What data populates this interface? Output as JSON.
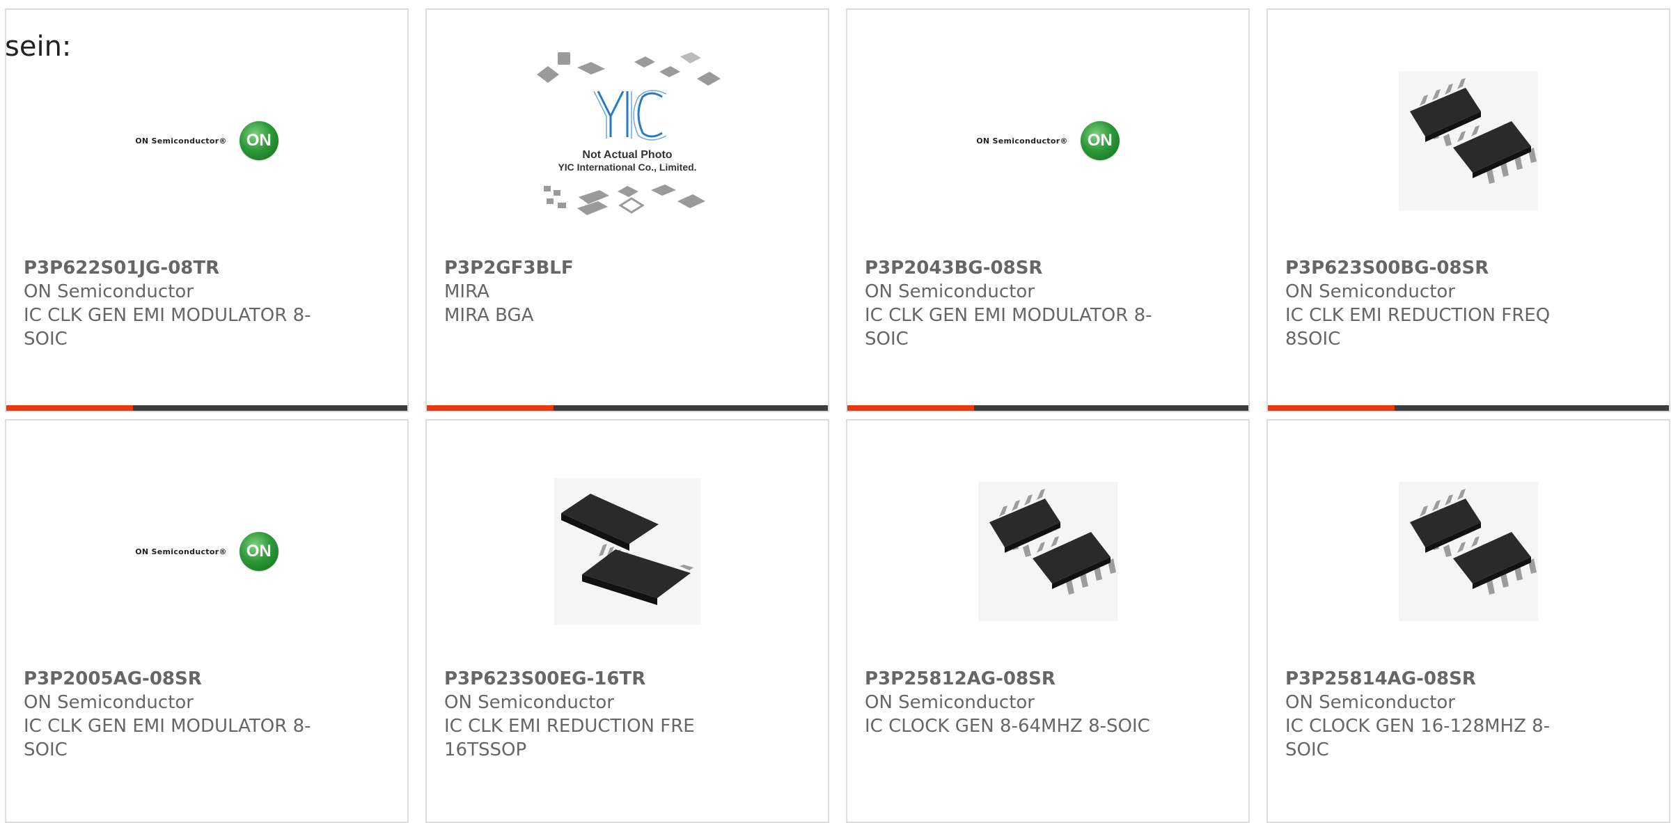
{
  "intro_text": "sein:",
  "colors": {
    "accent": "#e8380d",
    "bar": "#3d3d3d",
    "border": "#dddddd",
    "text": "#666666"
  },
  "products": [
    {
      "part": "P3P622S01JG-08TR",
      "manufacturer": "ON Semiconductor",
      "description": "IC CLK GEN EMI MODULATOR 8-SOIC",
      "image": "on-semiconductor-logo",
      "logo_text": "ON Semiconductor®",
      "logo_mark": "ON"
    },
    {
      "part": "P3P2GF3BLF",
      "manufacturer": "MIRA",
      "description": "MIRA BGA",
      "image": "yic-placeholder-photo",
      "placeholder_logo": "YIC",
      "placeholder_line1": "Not Actual Photo",
      "placeholder_line2": "YIC International Co., Limited."
    },
    {
      "part": "P3P2043BG-08SR",
      "manufacturer": "ON Semiconductor",
      "description": "IC CLK GEN EMI MODULATOR 8-SOIC",
      "image": "on-semiconductor-logo",
      "logo_text": "ON Semiconductor®",
      "logo_mark": "ON"
    },
    {
      "part": "P3P623S00BG-08SR",
      "manufacturer": "ON Semiconductor",
      "description": "IC CLK EMI REDUCTION FREQ 8SOIC",
      "image": "soic8-chip-photo"
    },
    {
      "part": "P3P2005AG-08SR",
      "manufacturer": "ON Semiconductor",
      "description": "IC CLK GEN EMI MODULATOR 8-SOIC",
      "image": "on-semiconductor-logo",
      "logo_text": "ON Semiconductor®",
      "logo_mark": "ON"
    },
    {
      "part": "P3P623S00EG-16TR",
      "manufacturer": "ON Semiconductor",
      "description": "IC CLK EMI REDUCTION FRE 16TSSOP",
      "image": "tssop16-chip-photo"
    },
    {
      "part": "P3P25812AG-08SR",
      "manufacturer": "ON Semiconductor",
      "description": "IC CLOCK GEN 8-64MHZ 8-SOIC",
      "image": "soic8-chip-photo"
    },
    {
      "part": "P3P25814AG-08SR",
      "manufacturer": "ON Semiconductor",
      "description": "IC CLOCK GEN 16-128MHZ 8-SOIC",
      "image": "soic8-chip-photo"
    }
  ]
}
